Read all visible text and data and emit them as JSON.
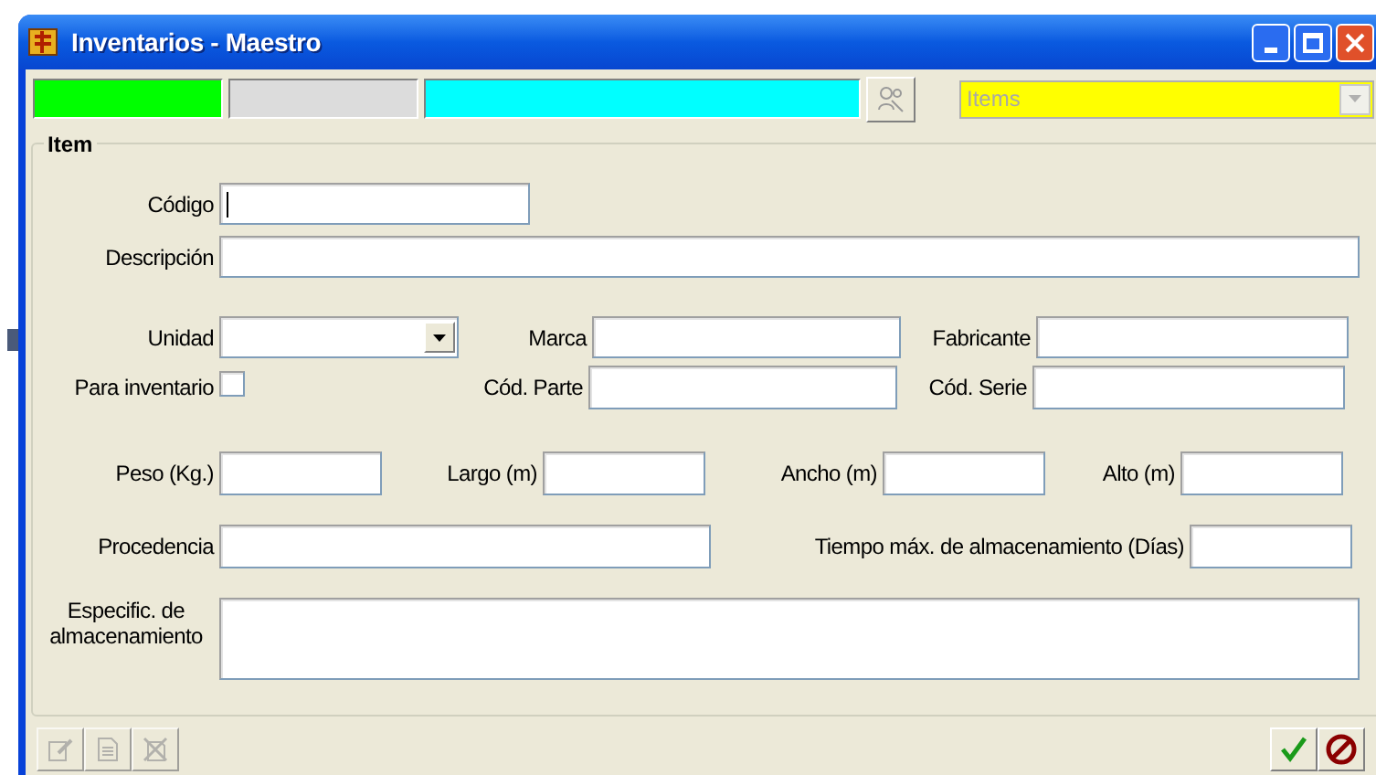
{
  "window": {
    "title": "Inventarios - Maestro"
  },
  "toolbar": {
    "panels": [
      {
        "color": "#00ff00"
      },
      {
        "color": "#dcdcdc"
      },
      {
        "color": "#00ffff"
      }
    ],
    "combo": {
      "value": "Items",
      "disabled": true,
      "color": "#ffff00"
    }
  },
  "group": {
    "title": "Item"
  },
  "rows": [
    [
      {
        "label": "Código",
        "kind": "text",
        "focused": true
      }
    ],
    [
      {
        "label": "Descripción",
        "kind": "text",
        "focused": false
      }
    ],
    [
      {
        "label": "Unidad",
        "kind": "dropdown"
      },
      {
        "label": "Marca",
        "kind": "text",
        "focused": false
      },
      {
        "label": "Fabricante",
        "kind": "text",
        "focused": false
      }
    ],
    [
      {
        "label": "Para inventario",
        "kind": "checkbox",
        "checked": false
      },
      {
        "label": "Cód. Parte",
        "kind": "text",
        "focused": false
      },
      {
        "label": "Cód. Serie",
        "kind": "text",
        "focused": false
      }
    ],
    [
      {
        "label": "Peso (Kg.)",
        "kind": "text",
        "focused": false
      },
      {
        "label": "Largo (m)",
        "kind": "text",
        "focused": false
      },
      {
        "label": "Ancho (m)",
        "kind": "text",
        "focused": false
      },
      {
        "label": "Alto (m)",
        "kind": "text",
        "focused": false
      }
    ],
    [
      {
        "label": "Procedencia",
        "kind": "text",
        "focused": false
      },
      {
        "label": "Tiempo máx. de almacenamiento (Días)",
        "kind": "text",
        "focused": false
      }
    ],
    [
      {
        "label": "Especific. de almacenamiento",
        "kind": "textarea"
      }
    ]
  ],
  "bottom": {
    "left_buttons": [
      {
        "kind": "edit",
        "disabled": true
      },
      {
        "kind": "new",
        "disabled": true
      },
      {
        "kind": "delete",
        "disabled": true
      }
    ],
    "right_buttons": [
      {
        "kind": "accept"
      },
      {
        "kind": "cancel"
      }
    ]
  }
}
